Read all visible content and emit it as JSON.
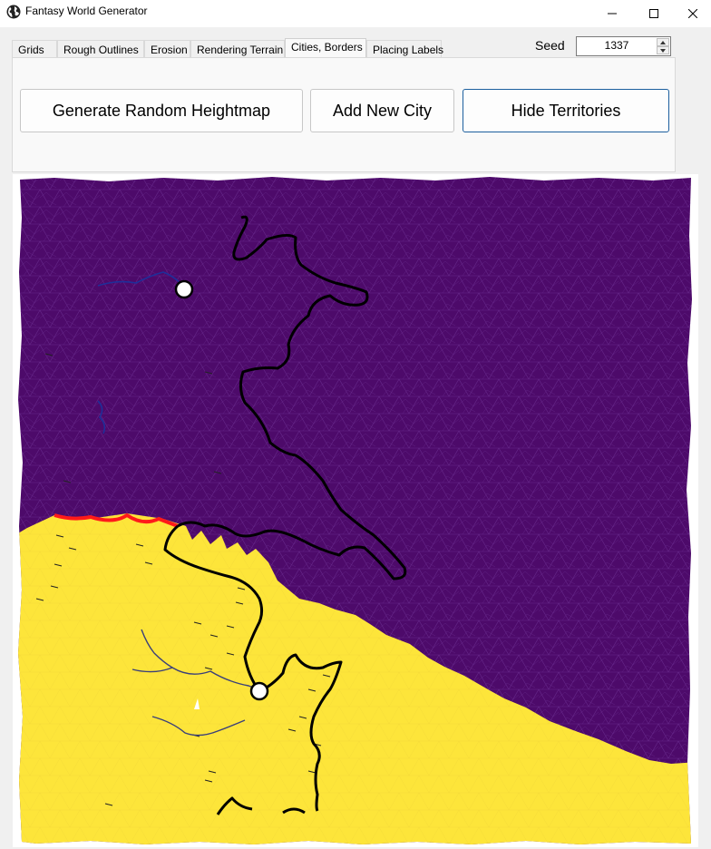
{
  "window": {
    "title": "Fantasy World Generator",
    "icon": "globe-icon"
  },
  "tabs": [
    {
      "label": "Grids",
      "active": false
    },
    {
      "label": "Rough Outlines",
      "active": false
    },
    {
      "label": "Erosion",
      "active": false
    },
    {
      "label": "Rendering Terrain",
      "active": false
    },
    {
      "label": "Cities, Borders",
      "active": true
    },
    {
      "label": "Placing Labels",
      "active": false
    }
  ],
  "seed": {
    "label": "Seed",
    "value": "1337"
  },
  "actions": {
    "generate_label": "Generate Random Heightmap",
    "add_city_label": "Add New City",
    "hide_territories_label": "Hide Territories"
  },
  "map": {
    "territory_colors": {
      "north": "#4d0a6a",
      "south": "#fde53a"
    },
    "border_color": "#000000",
    "contested_border_color": "#ff1a1a",
    "river_color": "#1f2f9a",
    "cities": 2
  }
}
